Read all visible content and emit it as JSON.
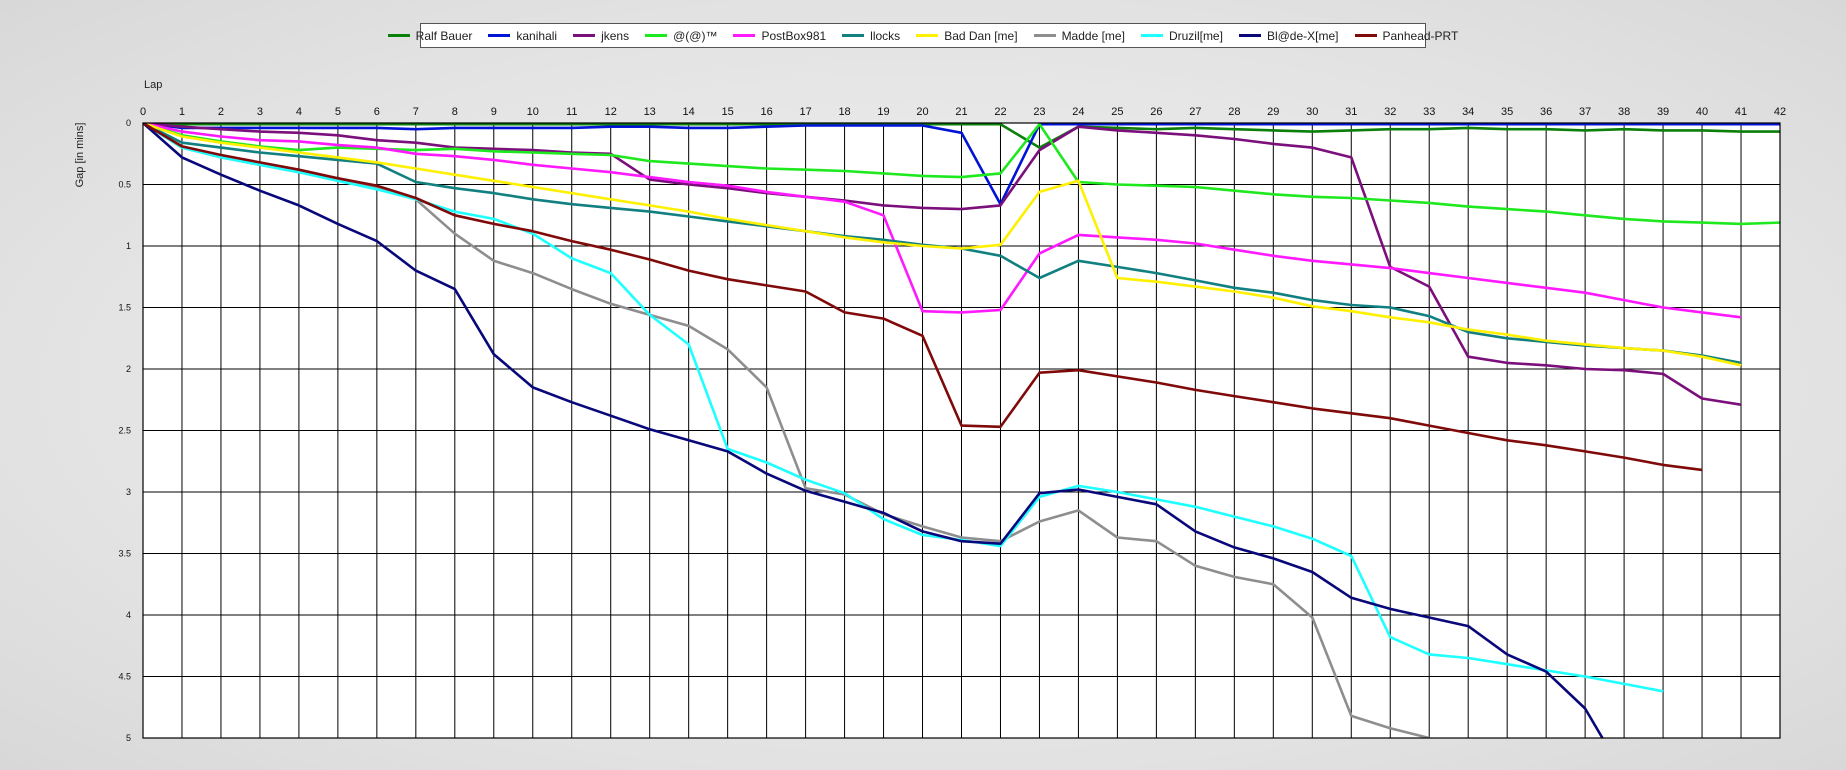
{
  "chart_data": {
    "type": "line",
    "xlabel": "Lap",
    "ylabel": "Gap [in mins]",
    "xlim": [
      0,
      42
    ],
    "ylim": [
      0,
      5
    ],
    "y_inverted": true,
    "grid": true,
    "legend_placement": "top-center",
    "x_ticks": [
      "0",
      "1",
      "2",
      "3",
      "4",
      "5",
      "6",
      "7",
      "8",
      "9",
      "10",
      "11",
      "12",
      "13",
      "14",
      "15",
      "16",
      "17",
      "18",
      "19",
      "20",
      "21",
      "22",
      "23",
      "24",
      "25",
      "26",
      "27",
      "28",
      "29",
      "30",
      "31",
      "32",
      "33",
      "34",
      "35",
      "36",
      "37",
      "38",
      "39",
      "40",
      "41",
      "42"
    ],
    "y_ticks": [
      "0",
      "0.5",
      "1",
      "1.5",
      "2",
      "2.5",
      "3",
      "3.5",
      "4",
      "4.5",
      "5"
    ],
    "series": [
      {
        "name": "Ralf Bauer",
        "color": "#0a7f0a",
        "values": [
          0,
          0.01,
          0.01,
          0.01,
          0.01,
          0.01,
          0.01,
          0.01,
          0.01,
          0.01,
          0.01,
          0.01,
          0.01,
          0.01,
          0.01,
          0.01,
          0.01,
          0.01,
          0.01,
          0.01,
          0.01,
          0.01,
          0.01,
          0.2,
          0.03,
          0.04,
          0.05,
          0.04,
          0.05,
          0.06,
          0.07,
          0.06,
          0.05,
          0.05,
          0.04,
          0.05,
          0.05,
          0.06,
          0.05,
          0.06,
          0.06,
          0.07,
          0.07
        ]
      },
      {
        "name": "kanihali",
        "color": "#0014d8",
        "values": [
          0,
          0.04,
          0.04,
          0.04,
          0.04,
          0.04,
          0.04,
          0.05,
          0.04,
          0.04,
          0.04,
          0.04,
          0.03,
          0.03,
          0.04,
          0.04,
          0.03,
          0.02,
          0.02,
          0.02,
          0.02,
          0.08,
          0.66,
          0.01,
          0.01,
          0.01,
          0.01,
          0.01,
          0.01,
          0.01,
          0.01,
          0.01,
          0.01,
          0.01,
          0.01,
          0.01,
          0.01,
          0.01,
          0.01,
          0.01,
          0.01,
          0.01,
          0.01
        ]
      },
      {
        "name": "jkens",
        "color": "#7b0f7b",
        "values": [
          0,
          0.03,
          0.05,
          0.07,
          0.08,
          0.1,
          0.14,
          0.16,
          0.2,
          0.21,
          0.22,
          0.24,
          0.25,
          0.46,
          0.5,
          0.53,
          0.57,
          0.6,
          0.63,
          0.67,
          0.69,
          0.7,
          0.67,
          0.22,
          0.03,
          0.06,
          0.08,
          0.1,
          0.13,
          0.17,
          0.2,
          0.28,
          1.17,
          1.33,
          1.9,
          1.95,
          1.97,
          2.0,
          2.01,
          2.04,
          2.24,
          2.29
        ]
      },
      {
        "name": "@(@)™",
        "color": "#1ee81e",
        "values": [
          0,
          0.1,
          0.15,
          0.19,
          0.22,
          0.2,
          0.21,
          0.22,
          0.21,
          0.23,
          0.24,
          0.25,
          0.26,
          0.31,
          0.33,
          0.35,
          0.37,
          0.38,
          0.39,
          0.41,
          0.43,
          0.44,
          0.41,
          0.01,
          0.48,
          0.5,
          0.51,
          0.52,
          0.55,
          0.58,
          0.6,
          0.61,
          0.63,
          0.65,
          0.68,
          0.7,
          0.72,
          0.75,
          0.78,
          0.8,
          0.81,
          0.82,
          0.81
        ]
      },
      {
        "name": "PostBox981",
        "color": "#ff19ff",
        "values": [
          0,
          0.07,
          0.11,
          0.14,
          0.15,
          0.18,
          0.2,
          0.25,
          0.27,
          0.3,
          0.34,
          0.37,
          0.4,
          0.44,
          0.48,
          0.51,
          0.56,
          0.6,
          0.64,
          0.75,
          1.53,
          1.54,
          1.52,
          1.06,
          0.91,
          0.93,
          0.95,
          0.98,
          1.03,
          1.08,
          1.12,
          1.15,
          1.18,
          1.22,
          1.26,
          1.3,
          1.34,
          1.38,
          1.44,
          1.5,
          1.54,
          1.58
        ]
      },
      {
        "name": "llocks",
        "color": "#128080",
        "values": [
          0,
          0.16,
          0.2,
          0.24,
          0.27,
          0.3,
          0.33,
          0.48,
          0.53,
          0.57,
          0.62,
          0.66,
          0.69,
          0.72,
          0.76,
          0.8,
          0.84,
          0.88,
          0.92,
          0.95,
          0.99,
          1.02,
          1.08,
          1.26,
          1.12,
          1.17,
          1.22,
          1.28,
          1.34,
          1.38,
          1.44,
          1.48,
          1.5,
          1.57,
          1.7,
          1.75,
          1.78,
          1.81,
          1.83,
          1.85,
          1.89,
          1.95
        ]
      },
      {
        "name": "Bad Dan [me]",
        "color": "#fff000",
        "values": [
          0,
          0.11,
          0.16,
          0.2,
          0.24,
          0.28,
          0.32,
          0.37,
          0.42,
          0.47,
          0.52,
          0.57,
          0.62,
          0.67,
          0.72,
          0.78,
          0.83,
          0.88,
          0.93,
          0.97,
          1.0,
          1.02,
          0.99,
          0.56,
          0.47,
          1.26,
          1.29,
          1.33,
          1.37,
          1.42,
          1.49,
          1.53,
          1.58,
          1.62,
          1.68,
          1.72,
          1.77,
          1.8,
          1.83,
          1.85,
          1.9,
          1.97
        ]
      },
      {
        "name": "Madde [me]",
        "color": "#8e8e8e",
        "values": [
          0,
          0.2,
          0.28,
          0.34,
          0.4,
          0.45,
          0.52,
          0.62,
          0.9,
          1.12,
          1.22,
          1.35,
          1.47,
          1.56,
          1.65,
          1.84,
          2.15,
          2.97,
          3.02,
          3.18,
          3.28,
          3.37,
          3.4,
          3.24,
          3.15,
          3.37,
          3.4,
          3.6,
          3.69,
          3.75,
          4.02,
          4.82,
          4.92,
          5.0
        ]
      },
      {
        "name": "Druzil[me]",
        "color": "#1effff",
        "values": [
          0,
          0.2,
          0.28,
          0.34,
          0.4,
          0.47,
          0.54,
          0.62,
          0.72,
          0.78,
          0.9,
          1.1,
          1.22,
          1.56,
          1.8,
          2.65,
          2.76,
          2.9,
          3.01,
          3.22,
          3.35,
          3.39,
          3.44,
          3.04,
          2.95,
          3.0,
          3.06,
          3.12,
          3.2,
          3.28,
          3.38,
          3.52,
          4.18,
          4.32,
          4.35,
          4.4,
          4.45,
          4.5,
          4.56,
          4.62
        ]
      },
      {
        "name": "Bl@de-X[me]",
        "color": "#08087a",
        "values": [
          0,
          0.28,
          0.42,
          0.55,
          0.67,
          0.82,
          0.96,
          1.2,
          1.35,
          1.88,
          2.15,
          2.27,
          2.38,
          2.49,
          2.58,
          2.67,
          2.85,
          2.99,
          3.08,
          3.17,
          3.32,
          3.4,
          3.42,
          3.01,
          2.98,
          3.04,
          3.1,
          3.32,
          3.45,
          3.54,
          3.65,
          3.86,
          3.95,
          4.02,
          4.09,
          4.32,
          4.46,
          4.76,
          5.3
        ]
      },
      {
        "name": "Panhead-PRT",
        "color": "#800a0a",
        "values": [
          0,
          0.19,
          0.26,
          0.32,
          0.38,
          0.45,
          0.51,
          0.61,
          0.75,
          0.82,
          0.88,
          0.96,
          1.03,
          1.11,
          1.2,
          1.27,
          1.32,
          1.37,
          1.54,
          1.59,
          1.73,
          2.46,
          2.47,
          2.03,
          2.01,
          2.06,
          2.11,
          2.17,
          2.22,
          2.27,
          2.32,
          2.36,
          2.4,
          2.46,
          2.52,
          2.58,
          2.62,
          2.67,
          2.72,
          2.78,
          2.82
        ]
      }
    ]
  }
}
